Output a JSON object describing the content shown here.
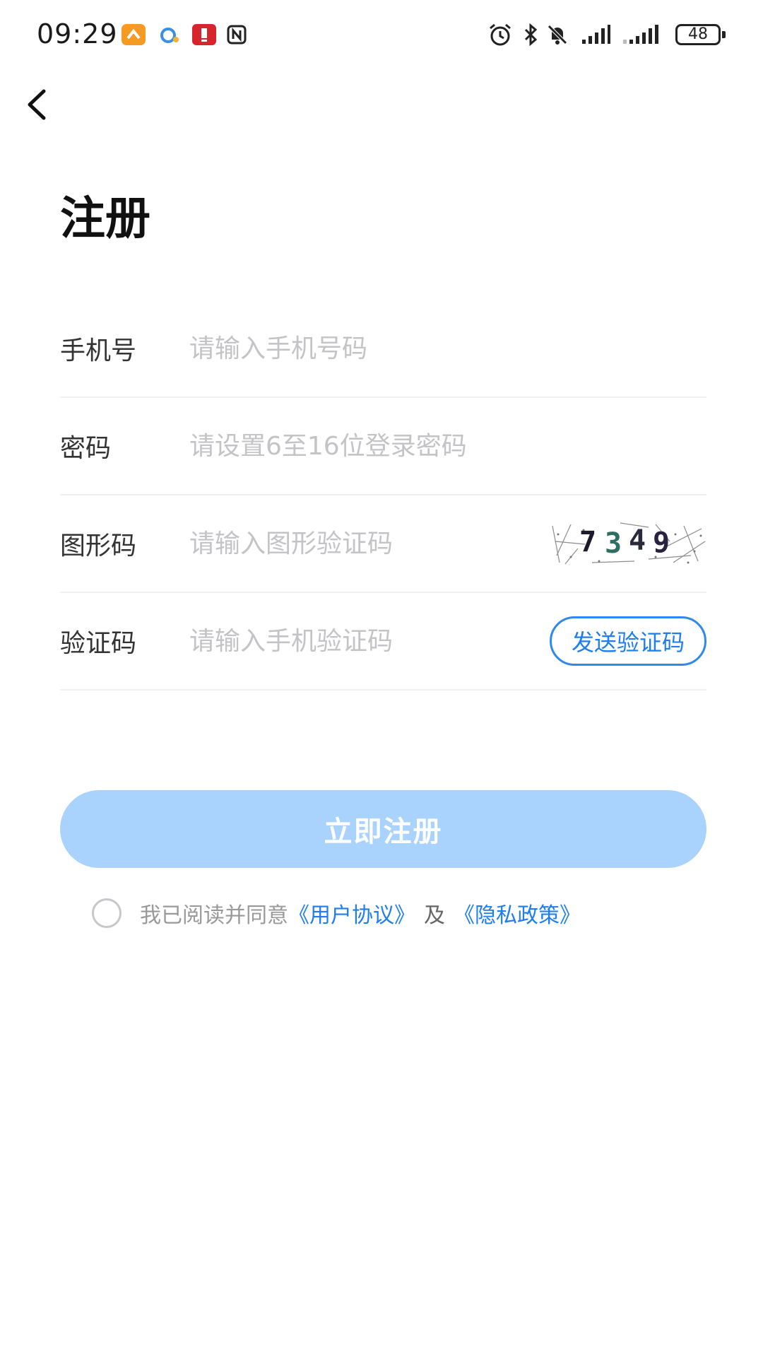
{
  "status_bar": {
    "time": "09:29",
    "battery": "48"
  },
  "page": {
    "title": "注册"
  },
  "form": {
    "phone": {
      "label": "手机号",
      "placeholder": "请输入手机号码"
    },
    "password": {
      "label": "密码",
      "placeholder": "请设置6至16位登录密码"
    },
    "captcha": {
      "label": "图形码",
      "placeholder": "请输入图形验证码",
      "digits": [
        "7",
        "3",
        "4",
        "9"
      ]
    },
    "sms_code": {
      "label": "验证码",
      "placeholder": "请输入手机验证码",
      "send_label": "发送验证码"
    }
  },
  "register_button": {
    "label": "立即注册"
  },
  "agreement": {
    "prefix": "我已阅读并同意",
    "user_agreement": "《用户协议》",
    "separator": "及",
    "privacy_policy": "《隐私政策》"
  },
  "colors": {
    "accent": "#1e7ef0",
    "button_disabled": "#a9d3fc",
    "placeholder": "#c4c4c8"
  }
}
